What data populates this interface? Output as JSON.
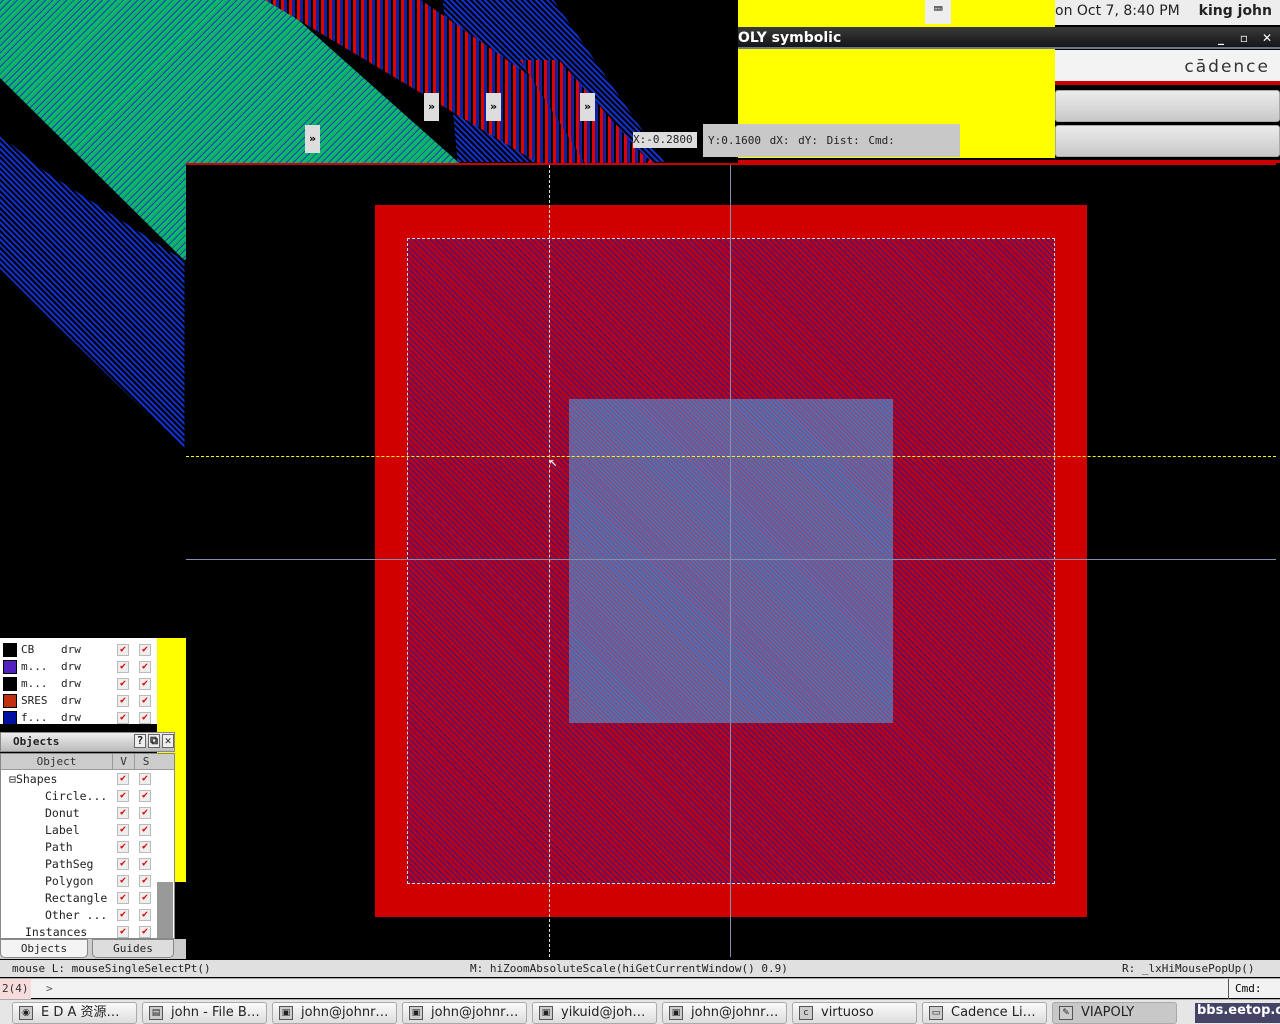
{
  "topbar": {
    "datetime": "on Oct  7,  8:40 PM",
    "user": "king john"
  },
  "window": {
    "title": "OLY symbolic",
    "brand": "cādence",
    "minimize": "_",
    "maximize": "▫",
    "close": "✕"
  },
  "coords": {
    "x": "X:-0.2800",
    "rest": "Y:0.1600  dX:  dY:  Dist:  Cmd:"
  },
  "chevron": "»",
  "layers": [
    {
      "name": "CB",
      "purpose": "drw",
      "color": "#000000"
    },
    {
      "name": "m...",
      "purpose": "drw",
      "color": "#5020c0"
    },
    {
      "name": "m...",
      "purpose": "drw",
      "color": "#000000"
    },
    {
      "name": "SRES",
      "purpose": "drw",
      "color": "#c03010"
    },
    {
      "name": "f...",
      "purpose": "drw",
      "color": "#0010a0"
    }
  ],
  "objects": {
    "title": "Objects",
    "help": "?",
    "float": "⧉",
    "close": "✕",
    "headers": {
      "object": "Object",
      "v": "V",
      "s": "S"
    },
    "rows": [
      {
        "label": "Shapes",
        "indent": 0
      },
      {
        "label": "Circle...",
        "indent": 1
      },
      {
        "label": "Donut",
        "indent": 1
      },
      {
        "label": "Label",
        "indent": 1
      },
      {
        "label": "Path",
        "indent": 1
      },
      {
        "label": "PathSeg",
        "indent": 1
      },
      {
        "label": "Polygon",
        "indent": 1
      },
      {
        "label": "Rectangle",
        "indent": 1
      },
      {
        "label": "Other ...",
        "indent": 1
      },
      {
        "label": "Instances",
        "indent": 0
      }
    ],
    "tabs": [
      "Objects",
      "Guides"
    ]
  },
  "checkmark": "✔",
  "status": {
    "left": "mouse L: mouseSingleSelectPt()",
    "middle": "M: hiZoomAbsoluteScale(hiGetCurrentWindow() 0.9)",
    "right": "R: _lxHiMousePopUp()"
  },
  "cmdline": {
    "prompt": "2(4)",
    "arrow": ">",
    "cmd": "Cmd:"
  },
  "taskbar": [
    {
      "label": "E D A 资源…",
      "icon": "firefox-icon"
    },
    {
      "label": "john - File B…",
      "icon": "file-browser-icon"
    },
    {
      "label": "john@johnr…",
      "icon": "terminal-icon"
    },
    {
      "label": "john@johnr…",
      "icon": "terminal-icon"
    },
    {
      "label": "yikuid@joh…",
      "icon": "terminal-icon"
    },
    {
      "label": "john@johnr…",
      "icon": "terminal-icon"
    },
    {
      "label": "virtuoso",
      "icon": "cadence-icon"
    },
    {
      "label": "Cadence Li…",
      "icon": "window-icon"
    },
    {
      "label": "VIAPOLY",
      "icon": "layout-icon"
    }
  ],
  "watermark": "bbs.eetop.cn"
}
